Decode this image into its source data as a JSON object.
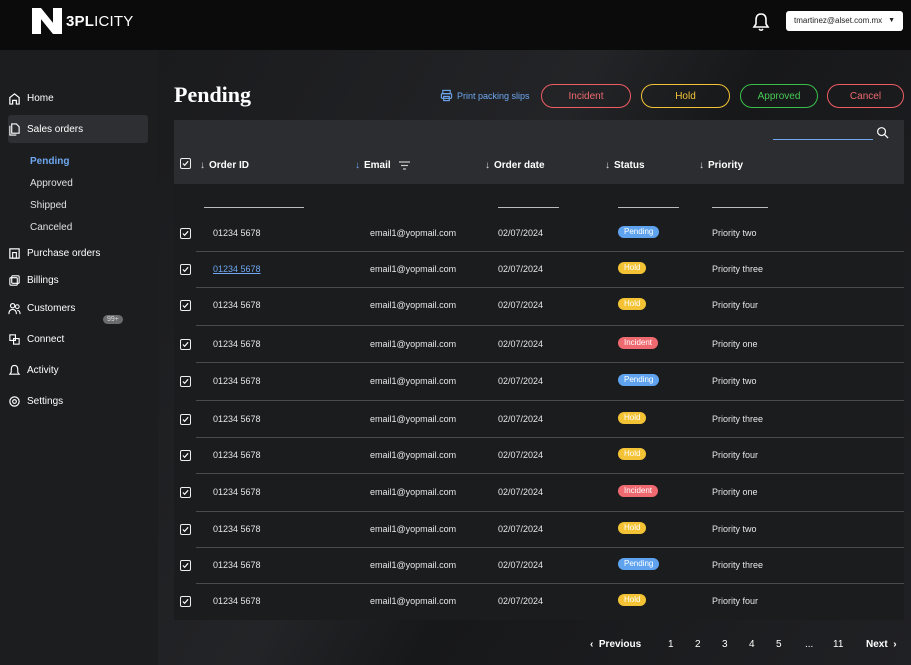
{
  "brand": {
    "bold": "3PL",
    "light": "ICITY"
  },
  "header": {
    "user_email": "tmartinez@alset.com.mx"
  },
  "sidebar": {
    "home": "Home",
    "sales_orders": "Sales orders",
    "sub": [
      "Pending",
      "Approved",
      "Shipped",
      "Canceled"
    ],
    "purchase_orders": "Purchase orders",
    "billings": "Billings",
    "customers": "Customers",
    "connect": "Connect",
    "activity": "Activity",
    "activity_badge": "99+",
    "settings": "Settings"
  },
  "page": {
    "title": "Pending",
    "print_label": "Print packing slips",
    "actions": {
      "incident": "Incident",
      "hold": "Hold",
      "approved": "Approved",
      "cancel": "Cancel"
    }
  },
  "table": {
    "headers": {
      "order_id": "Order ID",
      "email": "Email",
      "order_date": "Order date",
      "status": "Status",
      "priority": "Priority"
    },
    "rows": [
      {
        "order_id": "01234 5678",
        "email": "email1@yopmail.com",
        "date": "02/07/2024",
        "status": "Pending",
        "priority": "Priority two"
      },
      {
        "order_id": "01234 5678",
        "email": "email1@yopmail.com",
        "date": "02/07/2024",
        "status": "Hold",
        "priority": "Priority three"
      },
      {
        "order_id": "01234 5678",
        "email": "email1@yopmail.com",
        "date": "02/07/2024",
        "status": "Hold",
        "priority": "Priority four"
      },
      {
        "order_id": "01234 5678",
        "email": "email1@yopmail.com",
        "date": "02/07/2024",
        "status": "Incident",
        "priority": "Priority one"
      },
      {
        "order_id": "01234 5678",
        "email": "email1@yopmail.com",
        "date": "02/07/2024",
        "status": "Pending",
        "priority": "Priority two"
      },
      {
        "order_id": "01234 5678",
        "email": "email1@yopmail.com",
        "date": "02/07/2024",
        "status": "Hold",
        "priority": "Priority three"
      },
      {
        "order_id": "01234 5678",
        "email": "email1@yopmail.com",
        "date": "02/07/2024",
        "status": "Hold",
        "priority": "Priority four"
      },
      {
        "order_id": "01234 5678",
        "email": "email1@yopmail.com",
        "date": "02/07/2024",
        "status": "Incident",
        "priority": "Priority one"
      },
      {
        "order_id": "01234 5678",
        "email": "email1@yopmail.com",
        "date": "02/07/2024",
        "status": "Hold",
        "priority": "Priority two"
      },
      {
        "order_id": "01234 5678",
        "email": "email1@yopmail.com",
        "date": "02/07/2024",
        "status": "Pending",
        "priority": "Priority three"
      },
      {
        "order_id": "01234 5678",
        "email": "email1@yopmail.com",
        "date": "02/07/2024",
        "status": "Hold",
        "priority": "Priority four"
      }
    ]
  },
  "pagination": {
    "previous": "Previous",
    "pages": [
      "1",
      "2",
      "3",
      "4",
      "5",
      "...",
      "11"
    ],
    "next": "Next"
  },
  "colors": {
    "accent": "#6fa8f0",
    "incident": "#ef6a70",
    "hold": "#f3c335",
    "approved": "#47c955"
  }
}
